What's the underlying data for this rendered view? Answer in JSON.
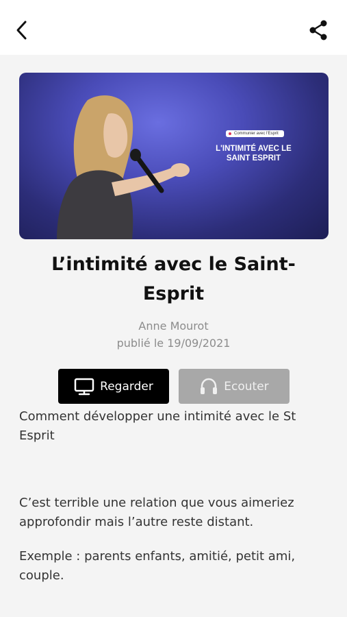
{
  "header": {
    "back_icon": "chevron-left-icon",
    "share_icon": "share-icon"
  },
  "hero": {
    "tag": "Communier avec l'Esprit",
    "title": "L'INTIMITÉ AVEC LE SAINT ESPRIT",
    "background_colors": [
      "#6a6ee0",
      "#2c2d78"
    ]
  },
  "sermon": {
    "title": "L’intimité avec le Saint-Esprit",
    "author": "Anne Mourot",
    "published": "publié le 19/09/2021"
  },
  "actions": {
    "watch_label": "Regarder",
    "watch_icon": "tv-icon",
    "listen_label": "Ecouter",
    "listen_icon": "headphones-icon"
  },
  "description": {
    "p1": "Comment développer une intimité avec le St Esprit",
    "p2": "C’est terrible une relation que vous aimeriez approfondir mais l’autre reste distant.",
    "p3": "Exemple : parents enfants, amitié, petit ami, couple."
  },
  "colors": {
    "primary_button": "#000000",
    "disabled_button": "#a8a8a8",
    "muted_text": "#8c8c8c"
  }
}
